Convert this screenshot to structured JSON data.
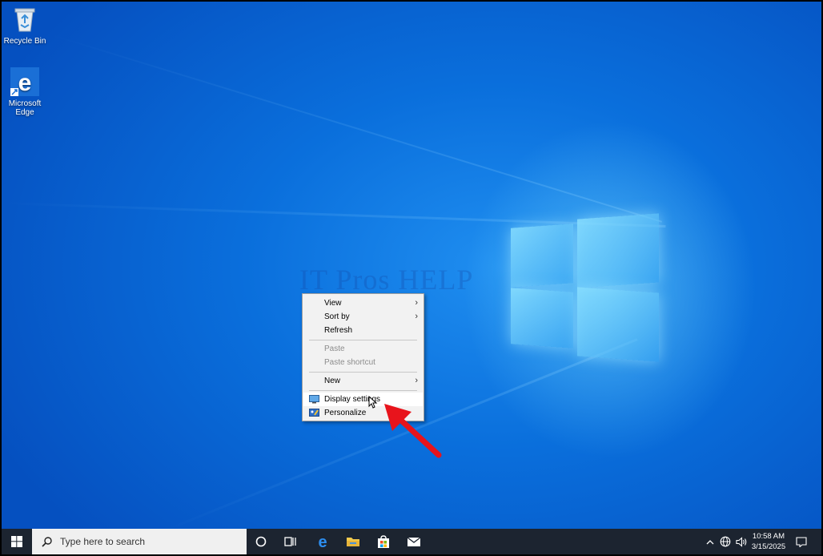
{
  "desktop": {
    "icons": [
      {
        "label": "Recycle Bin",
        "icon": "recycle-bin-icon"
      },
      {
        "label": "Microsoft\nEdge",
        "label_line1": "Microsoft",
        "label_line2": "Edge",
        "icon": "edge-icon"
      }
    ],
    "watermark": "IT Pros HELP"
  },
  "context_menu": {
    "items": [
      {
        "label": "View",
        "submenu": true,
        "enabled": true
      },
      {
        "label": "Sort by",
        "submenu": true,
        "enabled": true
      },
      {
        "label": "Refresh",
        "submenu": false,
        "enabled": true
      },
      {
        "label": "Paste",
        "submenu": false,
        "enabled": false
      },
      {
        "label": "Paste shortcut",
        "submenu": false,
        "enabled": false
      },
      {
        "label": "New",
        "submenu": true,
        "enabled": true
      },
      {
        "label": "Display settings",
        "submenu": false,
        "enabled": true,
        "icon": "display-icon",
        "highlighted": true
      },
      {
        "label": "Personalize",
        "submenu": false,
        "enabled": true,
        "icon": "personalize-icon"
      }
    ],
    "submenu_glyph": "›"
  },
  "taskbar": {
    "search_placeholder": "Type here to search",
    "pinned": [
      "cortana-icon",
      "task-view-icon",
      "edge-icon",
      "file-explorer-icon",
      "store-icon",
      "mail-icon"
    ],
    "tray": {
      "chevron": "^",
      "time": "10:58 AM",
      "date": "3/15/2025"
    }
  },
  "colors": {
    "accent_arrow": "#e8141c",
    "taskbar": "#1c2430",
    "menu_bg": "#f2f2f2"
  }
}
